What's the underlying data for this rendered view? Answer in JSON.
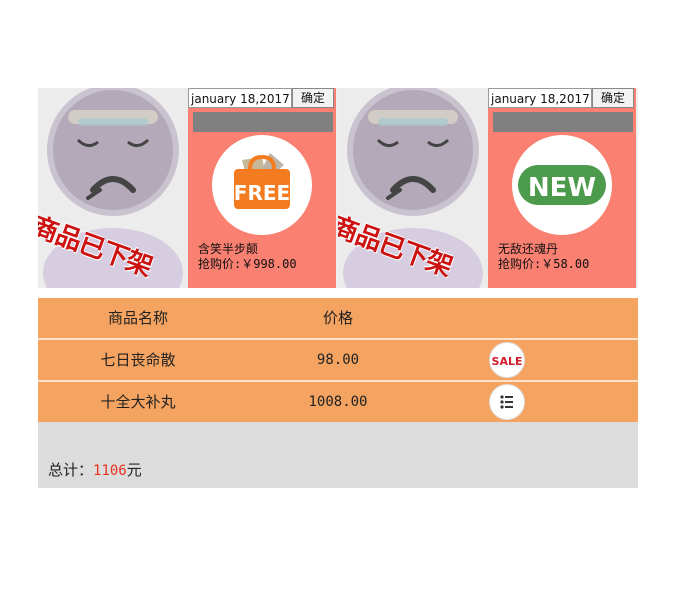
{
  "cards": [
    {
      "image": {
        "label": "商品已下架",
        "icon": "sad-face-sold-out"
      },
      "date_value": "january 18,2017",
      "confirm_label": "确定",
      "badge": {
        "icon": "free-bag-icon",
        "text": "FREE",
        "color": "#f47c20"
      },
      "name": "含笑半步颠",
      "price": "抢购价:￥998.00"
    },
    {
      "image": {
        "label": "商品已下架",
        "icon": "sad-face-sold-out"
      },
      "date_value": "january 18,2017",
      "confirm_label": "确定",
      "badge": {
        "icon": "new-badge-icon",
        "text": "NEW",
        "color": "#4c9a4c"
      },
      "name": "无敌还魂丹",
      "price": "抢购价:￥58.00"
    }
  ],
  "table": {
    "headers": [
      "商品名称",
      "价格"
    ],
    "rows": [
      {
        "name": "七日丧命散",
        "price": "98.00",
        "icon": "sale-icon",
        "icon_text": "SALE"
      },
      {
        "name": "十全大补丸",
        "price": "1008.00",
        "icon": "list-icon"
      }
    ]
  },
  "total": {
    "label": "总计：",
    "amount": "1106",
    "unit": "元"
  },
  "colors": {
    "card_bg": "#fa8072",
    "row_bg": "#f4a460",
    "total_bg": "#dcdcdc",
    "total_amount": "#e8301c",
    "stamp_red": "#cc1111"
  }
}
